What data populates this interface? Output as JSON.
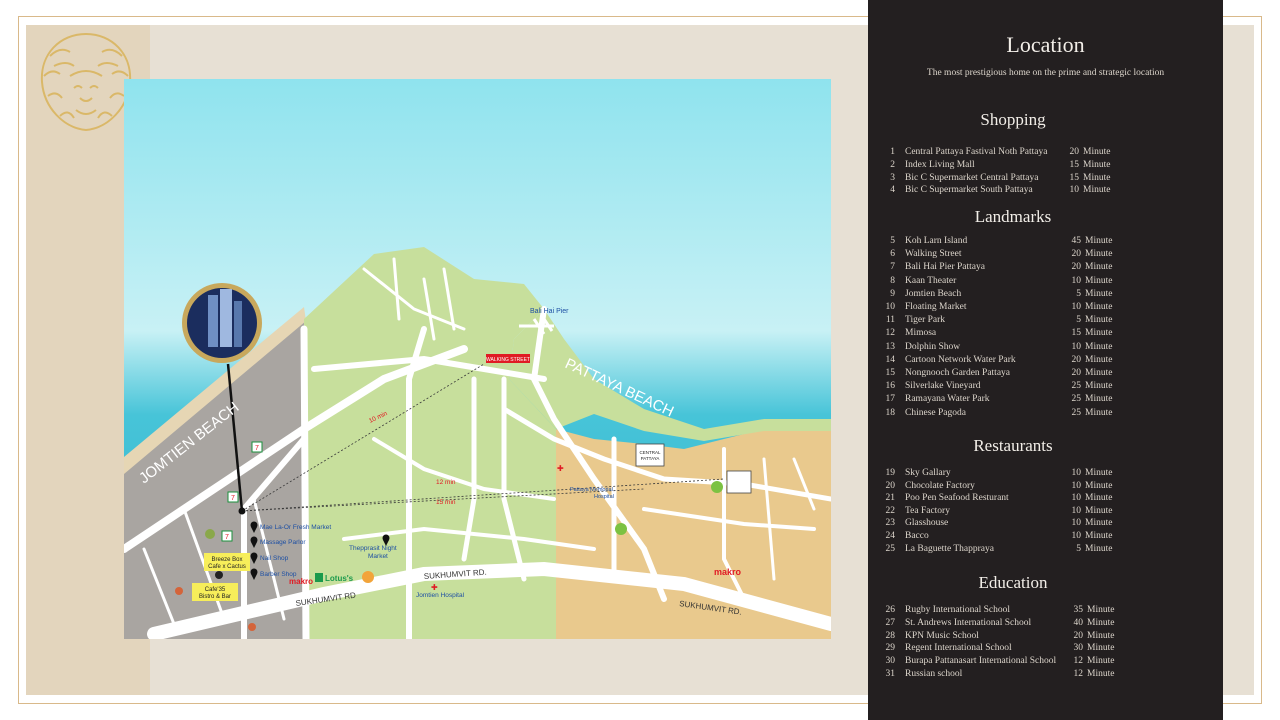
{
  "panel": {
    "title": "Location",
    "subtitle": "The most prestigious home on the prime and strategic location",
    "sections": [
      {
        "name": "Shopping",
        "items": [
          {
            "n": "1",
            "name": "Central Pattaya Fastival Noth Pattaya",
            "value": "20",
            "unit": "Minute"
          },
          {
            "n": "2",
            "name": "Index Living Mall",
            "value": "15",
            "unit": "Minute"
          },
          {
            "n": "3",
            "name": "Bic C Supermarket Central Pattaya",
            "value": "15",
            "unit": "Minute"
          },
          {
            "n": "4",
            "name": "Bic C Supermarket South Pattaya",
            "value": "10",
            "unit": "Minute"
          }
        ]
      },
      {
        "name": "Landmarks",
        "items": [
          {
            "n": "5",
            "name": "Koh Larn Island",
            "value": "45",
            "unit": "Minute"
          },
          {
            "n": "6",
            "name": "Walking Street",
            "value": "20",
            "unit": "Minute"
          },
          {
            "n": "7",
            "name": "Bali Hai Pier Pattaya",
            "value": "20",
            "unit": "Minute"
          },
          {
            "n": "8",
            "name": "Kaan Theater",
            "value": "10",
            "unit": "Minute"
          },
          {
            "n": "9",
            "name": "Jomtien Beach",
            "value": "5",
            "unit": "Minute"
          },
          {
            "n": "10",
            "name": "Floating Market",
            "value": "10",
            "unit": "Minute"
          },
          {
            "n": "11",
            "name": "Tiger Park",
            "value": "5",
            "unit": "Minute"
          },
          {
            "n": "12",
            "name": "Mimosa",
            "value": "15",
            "unit": "Minute"
          },
          {
            "n": "13",
            "name": "Dolphin Show",
            "value": "10",
            "unit": "Minute"
          },
          {
            "n": "14",
            "name": "Cartoon Network Water Park",
            "value": "20",
            "unit": "Minute"
          },
          {
            "n": "15",
            "name": "Nongnooch Garden Pattaya",
            "value": "20",
            "unit": "Minute"
          },
          {
            "n": "16",
            "name": "Silverlake  Vineyard",
            "value": "25",
            "unit": "Minute"
          },
          {
            "n": "17",
            "name": "Ramayana Water Park",
            "value": "25",
            "unit": "Minute"
          },
          {
            "n": "18",
            "name": "Chinese Pagoda",
            "value": "25",
            "unit": "Minute"
          }
        ]
      },
      {
        "name": "Restaurants",
        "items": [
          {
            "n": "19",
            "name": "Sky Gallary",
            "value": "10",
            "unit": "Minute"
          },
          {
            "n": "20",
            "name": "Chocolate Factory",
            "value": "10",
            "unit": "Minute"
          },
          {
            "n": "21",
            "name": "Poo Pen Seafood Resturant",
            "value": "10",
            "unit": "Minute"
          },
          {
            "n": "22",
            "name": "Tea Factory",
            "value": "10",
            "unit": "Minute"
          },
          {
            "n": "23",
            "name": "Glasshouse",
            "value": "10",
            "unit": "Minute"
          },
          {
            "n": "24",
            "name": "Bacco",
            "value": "10",
            "unit": "Minute"
          },
          {
            "n": "25",
            "name": "La Baguette Thappraya",
            "value": "5",
            "unit": "Minute"
          }
        ]
      },
      {
        "name": "Education",
        "items": [
          {
            "n": "26",
            "name": "Rugby International School",
            "value": "35",
            "unit": "Minute"
          },
          {
            "n": "27",
            "name": "St. Andrews International School",
            "value": "40",
            "unit": "Minute"
          },
          {
            "n": "28",
            "name": "KPN Music School",
            "value": "20",
            "unit": "Minute"
          },
          {
            "n": "29",
            "name": "Regent International School",
            "value": "30",
            "unit": "Minute"
          },
          {
            "n": "30",
            "name": "Burapa Pattanasart International School",
            "value": "12",
            "unit": "Minute"
          },
          {
            "n": "31",
            "name": "Russian school",
            "value": "12",
            "unit": "Minute"
          }
        ]
      }
    ]
  },
  "map": {
    "beach_jomtien": "JOMTIEN BEACH",
    "beach_pattaya": "PATTAYA BEACH",
    "bali_hai": "Bali Hai Pier",
    "walking_street": "WALKING STREET",
    "sukhumvit_1": "SUKHUMVIT RD.",
    "sukhumvit_2": "SUKHUMVIT RD",
    "sukhumvit_3": "SUKHUMVIT RD.",
    "dist_1": "10 min",
    "dist_2": "12 min",
    "dist_3": "15 min",
    "poi_market": "Mae La-Or Fresh Market",
    "poi_massage": "Massage Parlor",
    "poi_nail": "Nail Shop",
    "poi_barber": "Barber Shop",
    "cafe_1_line1": "Breeze Box",
    "cafe_1_line2": "Cafe x Cactus",
    "cafe_2_line1": "Cafe'35",
    "cafe_2_line2": "Bistro & Bar",
    "thepprasit_1": "Thepprasit Night",
    "thepprasit_2": "Market",
    "hospital_1_line1": "Pattaya Memorial",
    "hospital_1_line2": "Hospital",
    "hospital_2": "Jomtien Hospital",
    "brand_makro": "makro",
    "brand_lotus": "Lotus's",
    "central_1": "CENTRAL",
    "central_2": "PATTAYA"
  },
  "colors": {
    "panel_bg": "#231f20",
    "sea": "#3ec3d6",
    "land_green": "#c7df9c",
    "land_gray": "#a9a5a1",
    "land_sand": "#e9c98d",
    "road": "#ffffff",
    "accent_red": "#e01b24"
  }
}
